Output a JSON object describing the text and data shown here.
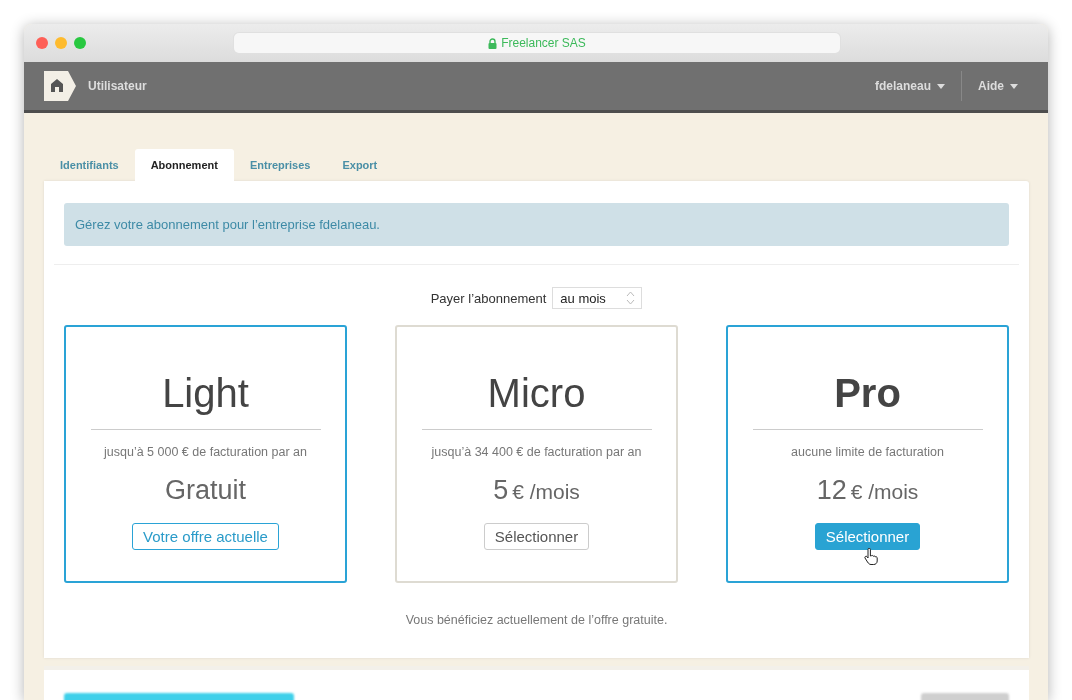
{
  "browser": {
    "address": "Freelancer SAS",
    "secure": true
  },
  "header": {
    "app_label": "Utilisateur",
    "menus": [
      {
        "label": "fdelaneau"
      },
      {
        "label": "Aide"
      }
    ]
  },
  "tabs": [
    {
      "label": "Identifiants",
      "selected": false
    },
    {
      "label": "Abonnement",
      "selected": true
    },
    {
      "label": "Entreprises",
      "selected": false
    },
    {
      "label": "Export",
      "selected": false
    }
  ],
  "notice": "Gérez votre abonnement pour l’entreprise fdelaneau.",
  "billing": {
    "label": "Payer l’abonnement",
    "value": "au mois"
  },
  "plans": [
    {
      "name": "Light",
      "description": "jusqu’à 5 000 € de facturation par an",
      "price": "Gratuit",
      "button": "Votre offre actuelle",
      "selected": true,
      "hovered": false
    },
    {
      "name": "Micro",
      "description": "jusqu’à 34 400 € de facturation par an",
      "price": "5",
      "unit": "€ /mois",
      "button": "Sélectionner",
      "selected": false,
      "hovered": false
    },
    {
      "name": "Pro",
      "description": "aucune limite de facturation",
      "price": "12",
      "unit": "€ /mois",
      "button": "Sélectionner",
      "selected": false,
      "hovered": true
    }
  ],
  "footnote": "Vous bénéficiez actuellement de l’offre gratuite.",
  "footer_buttons": [
    {
      "kind": "primary"
    },
    {
      "kind": "secondary"
    }
  ]
}
